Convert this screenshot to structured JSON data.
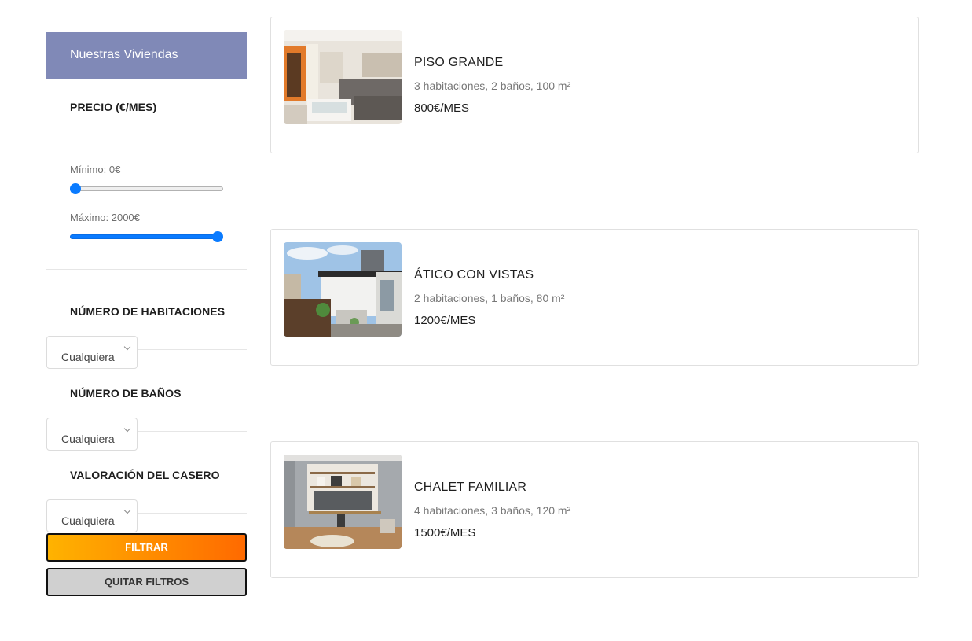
{
  "sidebar": {
    "title": "Nuestras Viviendas",
    "price": {
      "title": "PRECIO (€/MES)",
      "min_label": "Mínimo: 0€",
      "max_label": "Máximo: 2000€",
      "range_min": 0,
      "range_max": 2000,
      "min_value": 0,
      "max_value": 2000
    },
    "rooms": {
      "title": "NÚMERO DE HABITACIONES",
      "selected": "Cualquiera"
    },
    "baths": {
      "title": "NÚMERO DE BAÑOS",
      "selected": "Cualquiera"
    },
    "rating": {
      "title": "VALORACIÓN DEL CASERO",
      "selected": "Cualquiera"
    },
    "filter_button": "FILTRAR",
    "clear_button": "QUITAR FILTROS"
  },
  "listings": [
    {
      "title": "PISO GRANDE",
      "details": "3 habitaciones, 2 baños, 100 m²",
      "price": "800€/MES",
      "image": "living-room-photo"
    },
    {
      "title": "ÁTICO CON VISTAS",
      "details": "2 habitaciones, 1 baños, 80 m²",
      "price": "1200€/MES",
      "image": "terrace-photo"
    },
    {
      "title": "CHALET FAMILIAR",
      "details": "4 habitaciones, 3 baños, 120 m²",
      "price": "1500€/MES",
      "image": "study-room-photo"
    }
  ],
  "colors": {
    "header_bg": "#8089b7",
    "slider_blue": "#0a7bff",
    "filter_gradient_start": "#ffb300",
    "filter_gradient_end": "#ff6a00",
    "clear_bg": "#d0d0d0"
  }
}
